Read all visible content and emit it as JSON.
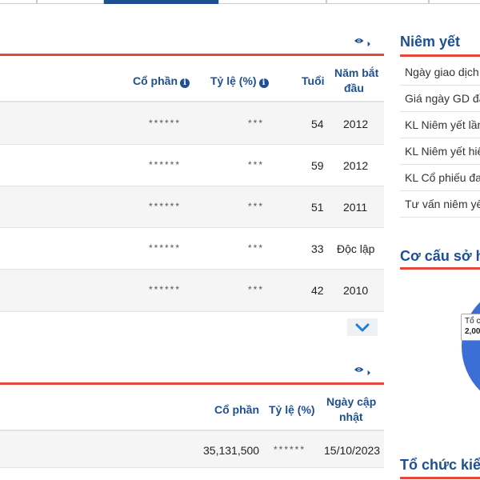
{
  "colors": {
    "brand": "#1d4f91",
    "accent_line": "#e2493b",
    "row_alt": "#f5f5f5"
  },
  "leadership_table": {
    "headers": {
      "shares": "Cổ phần",
      "ratio": "Tỷ lệ (%)",
      "age": "Tuổi",
      "start_year_l1": "Năm bắt",
      "start_year_l2": "đầu"
    },
    "rows": [
      {
        "shares": "******",
        "ratio": "***",
        "age": "54",
        "start_year": "2012"
      },
      {
        "shares": "******",
        "ratio": "***",
        "age": "59",
        "start_year": "2012"
      },
      {
        "shares": "******",
        "ratio": "***",
        "age": "51",
        "start_year": "2011"
      },
      {
        "shares": "******",
        "ratio": "***",
        "age": "33",
        "start_year": "Độc lập"
      },
      {
        "shares": "******",
        "ratio": "***",
        "age": "42",
        "start_year": "2010"
      }
    ]
  },
  "shareholder_table": {
    "headers": {
      "shares": "Cổ phần",
      "ratio": "Tỷ lệ (%)",
      "update_l1": "Ngày cập",
      "update_l2": "nhật"
    },
    "rows": [
      {
        "shares": "35,131,500",
        "ratio": "******",
        "update_date": "15/10/2023"
      }
    ]
  },
  "sidebar": {
    "listing_title": "Niêm yết",
    "listing_rows": [
      "Ngày giao dịch",
      "Giá ngày GD đầu",
      "KL Niêm yết lần",
      "KL Niêm yết hiện",
      "KL Cổ phiếu đang",
      "Tư vấn niêm yết"
    ],
    "ownership_title": "Cơ cấu sở hữu",
    "tooltip_label": "Tổ c",
    "tooltip_value": "2,00",
    "org_title": "Tổ chức kiểm"
  },
  "icons": {
    "eye": "eye-icon",
    "caret": "caret-right-icon",
    "chevron": "chevron-down-icon",
    "info": "info-icon"
  }
}
